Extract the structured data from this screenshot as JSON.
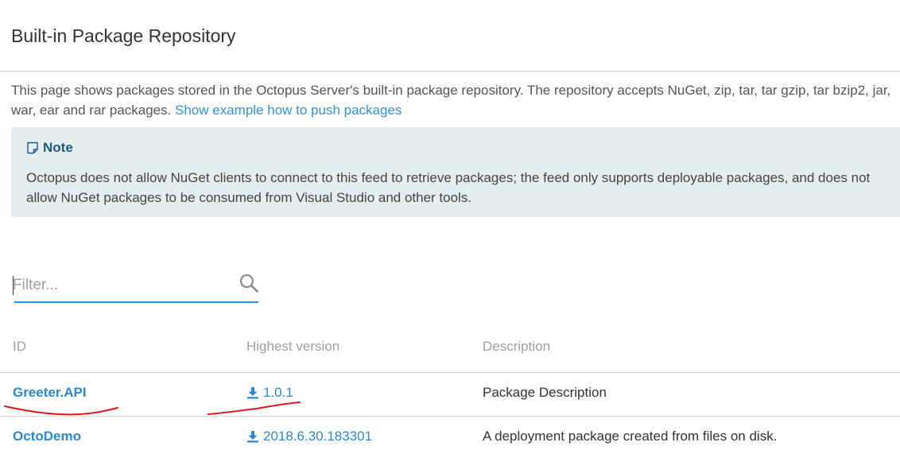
{
  "page": {
    "title": "Built-in Package Repository"
  },
  "intro": {
    "line1": "This page shows packages stored in the Octopus Server's built-in package repository. The repository accepts NuGet, zip, tar, tar gzip, tar bzip2, jar,",
    "line2": "war, ear and rar packages.",
    "link_label": "Show example how to push packages"
  },
  "note": {
    "icon": "note-icon",
    "heading": "Note",
    "line1": "Octopus does not allow NuGet clients to connect to this feed to retrieve packages; the feed only supports deployable packages, and does not",
    "line2": "allow NuGet packages to be consumed from Visual Studio and other tools."
  },
  "filter": {
    "placeholder": "Filter...",
    "value": "",
    "icon": "search-icon"
  },
  "table": {
    "headers": {
      "id": "ID",
      "version": "Highest version",
      "description": "Description"
    },
    "rows": [
      {
        "id": "Greeter.API",
        "version": "1.0.1",
        "description": "Package Description"
      },
      {
        "id": "OctoDemo",
        "version": "2018.6.30.183301",
        "description": "A deployment package created from files on disk."
      }
    ]
  },
  "colors": {
    "accent": "#2f93e0",
    "link": "#2a88d1",
    "note_background": "#e6edee",
    "note_heading": "#1e5a7e",
    "annotation_ink": "#e0141e"
  }
}
